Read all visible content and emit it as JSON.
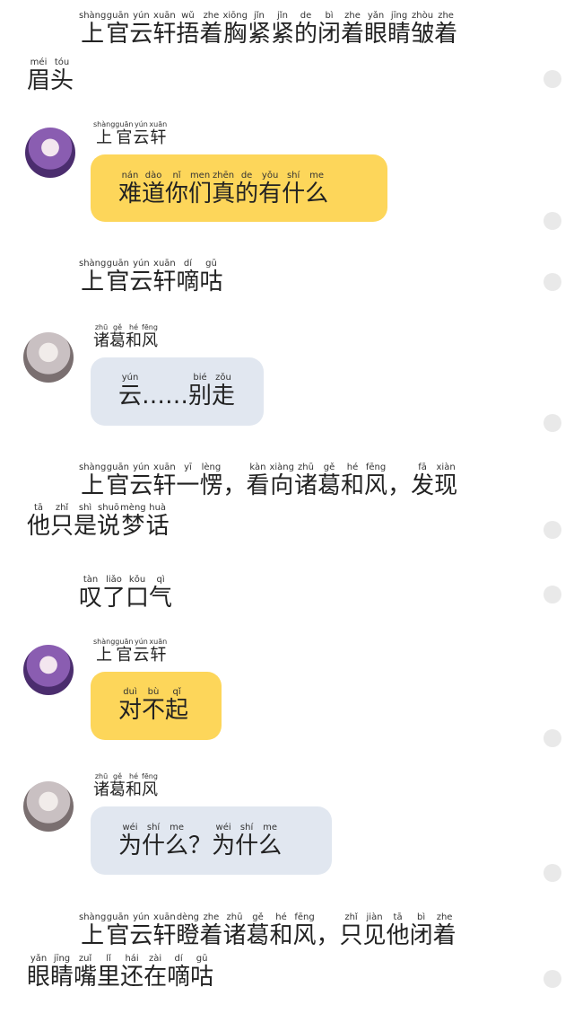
{
  "narrations": [
    {
      "lines": [
        [
          [
            "shàng",
            "上"
          ],
          [
            "guān",
            "官"
          ],
          [
            "yún",
            "云"
          ],
          [
            "xuān",
            "轩"
          ],
          [
            "wǔ",
            "捂"
          ],
          [
            "zhe",
            "着"
          ],
          [
            "xiōng",
            "胸"
          ],
          [
            "jǐn",
            "紧"
          ],
          [
            "jǐn",
            "紧"
          ],
          [
            "de",
            "的"
          ],
          [
            "bì",
            "闭"
          ],
          [
            "zhe",
            "着"
          ],
          [
            "yǎn",
            "眼"
          ],
          [
            "jīng",
            "睛"
          ],
          [
            "zhòu",
            "皱"
          ],
          [
            "zhe",
            "着"
          ]
        ],
        [
          [
            "méi",
            "眉"
          ],
          [
            "tóu",
            "头"
          ]
        ]
      ]
    },
    {
      "lines": [
        [
          [
            "shàng",
            "上"
          ],
          [
            "guān",
            "官"
          ],
          [
            "yún",
            "云"
          ],
          [
            "xuān",
            "轩"
          ],
          [
            "dí",
            "嘀"
          ],
          [
            "gū",
            "咕"
          ]
        ]
      ]
    },
    {
      "lines": [
        [
          [
            "shàng",
            "上"
          ],
          [
            "guān",
            "官"
          ],
          [
            "yún",
            "云"
          ],
          [
            "xuān",
            "轩"
          ],
          [
            "yī",
            "一"
          ],
          [
            "lèng",
            "愣"
          ],
          [
            "",
            "，"
          ],
          [
            "kàn",
            "看"
          ],
          [
            "xiàng",
            "向"
          ],
          [
            "zhū",
            "诸"
          ],
          [
            "gě",
            "葛"
          ],
          [
            "hé",
            "和"
          ],
          [
            "fēng",
            "风"
          ],
          [
            "",
            "，"
          ],
          [
            "fā",
            "发"
          ],
          [
            "xiàn",
            "现"
          ]
        ],
        [
          [
            "tā",
            "他"
          ],
          [
            "zhǐ",
            "只"
          ],
          [
            "shì",
            "是"
          ],
          [
            "shuō",
            "说"
          ],
          [
            "mèng",
            "梦"
          ],
          [
            "huà",
            "话"
          ]
        ]
      ]
    },
    {
      "lines": [
        [
          [
            "tàn",
            "叹"
          ],
          [
            "liǎo",
            "了"
          ],
          [
            "kǒu",
            "口"
          ],
          [
            "qì",
            "气"
          ]
        ]
      ]
    },
    {
      "lines": [
        [
          [
            "shàng",
            "上"
          ],
          [
            "guān",
            "官"
          ],
          [
            "yún",
            "云"
          ],
          [
            "xuān",
            "轩"
          ],
          [
            "dèng",
            "瞪"
          ],
          [
            "zhe",
            "着"
          ],
          [
            "zhū",
            "诸"
          ],
          [
            "gě",
            "葛"
          ],
          [
            "hé",
            "和"
          ],
          [
            "fēng",
            "风"
          ],
          [
            "",
            "，"
          ],
          [
            "zhǐ",
            "只"
          ],
          [
            "jiàn",
            "见"
          ],
          [
            "tā",
            "他"
          ],
          [
            "bì",
            "闭"
          ],
          [
            "zhe",
            "着"
          ]
        ],
        [
          [
            "yǎn",
            "眼"
          ],
          [
            "jīng",
            "睛"
          ],
          [
            "zuǐ",
            "嘴"
          ],
          [
            "lǐ",
            "里"
          ],
          [
            "hái",
            "还"
          ],
          [
            "zài",
            "在"
          ],
          [
            "dí",
            "嘀"
          ],
          [
            "gū",
            "咕"
          ]
        ]
      ]
    }
  ],
  "messages": [
    {
      "speaker": [
        [
          "shàng",
          "上"
        ],
        [
          "guān",
          "官"
        ],
        [
          "yún",
          "云"
        ],
        [
          "xuān",
          "轩"
        ]
      ],
      "text": [
        [
          "nán",
          "难"
        ],
        [
          "dào",
          "道"
        ],
        [
          "nǐ",
          "你"
        ],
        [
          "men",
          "们"
        ],
        [
          "zhēn",
          "真"
        ],
        [
          "de",
          "的"
        ],
        [
          "yǒu",
          "有"
        ],
        [
          "shí",
          "什"
        ],
        [
          "me",
          "么"
        ]
      ],
      "bubble_color": "#fdd65a",
      "avatar": "purple-hair-avatar"
    },
    {
      "speaker": [
        [
          "zhū",
          "诸"
        ],
        [
          "gě",
          "葛"
        ],
        [
          "hé",
          "和"
        ],
        [
          "fēng",
          "风"
        ]
      ],
      "text": [
        [
          "yún",
          "云"
        ],
        [
          "",
          "……"
        ],
        [
          "bié",
          "别"
        ],
        [
          "zǒu",
          "走"
        ]
      ],
      "bubble_color": "#e1e7f0",
      "avatar": "silver-hair-avatar"
    },
    {
      "speaker": [
        [
          "shàng",
          "上"
        ],
        [
          "guān",
          "官"
        ],
        [
          "yún",
          "云"
        ],
        [
          "xuān",
          "轩"
        ]
      ],
      "text": [
        [
          "duì",
          "对"
        ],
        [
          "bù",
          "不"
        ],
        [
          "qǐ",
          "起"
        ]
      ],
      "bubble_color": "#fdd65a",
      "avatar": "purple-hair-avatar"
    },
    {
      "speaker": [
        [
          "zhū",
          "诸"
        ],
        [
          "gě",
          "葛"
        ],
        [
          "hé",
          "和"
        ],
        [
          "fēng",
          "风"
        ]
      ],
      "text": [
        [
          "wéi",
          "为"
        ],
        [
          "shí",
          "什"
        ],
        [
          "me",
          "么"
        ],
        [
          "",
          "？"
        ],
        [
          "wéi",
          "为"
        ],
        [
          "shí",
          "什"
        ],
        [
          "me",
          "么"
        ]
      ],
      "bubble_color": "#e1e7f0",
      "avatar": "silver-hair-avatar"
    }
  ]
}
